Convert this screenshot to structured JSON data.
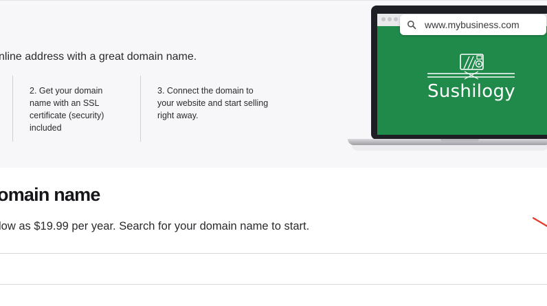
{
  "hero": {
    "subtitle": "nline address with a great domain name.",
    "steps": [
      {
        "text": "2. Get your domain name with an SSL certificate (security) included"
      },
      {
        "text": "3. Connect the domain to your website and start selling right away."
      }
    ]
  },
  "browser": {
    "url": "www.mybusiness.com",
    "icon": "search-icon"
  },
  "logo": {
    "name": "Sushilogy"
  },
  "section": {
    "title": "omain name",
    "description": " low as $19.99 per year. Search for your domain name to start."
  },
  "colors": {
    "screen_green": "#1f8a4a",
    "hero_background": "#f7f7f9",
    "accent_red": "#e23b2a"
  }
}
